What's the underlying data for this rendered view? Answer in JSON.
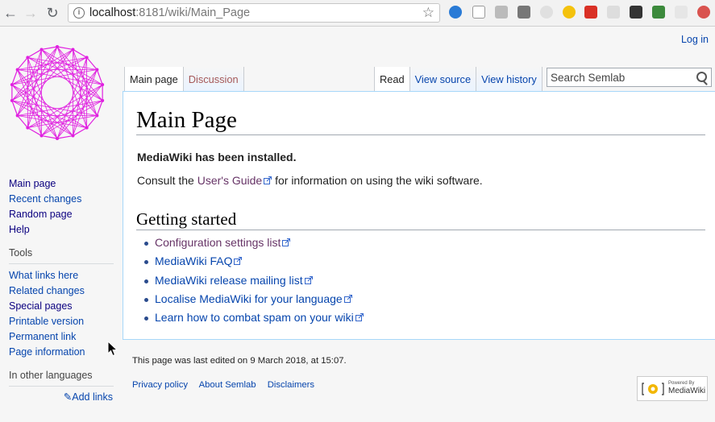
{
  "browser": {
    "url_host": "localhost",
    "url_rest": ":8181/wiki/Main_Page",
    "back_icon": "arrow-left-icon",
    "forward_icon": "arrow-right-icon",
    "reload_icon": "reload-icon",
    "bookmark_icon": "star-icon"
  },
  "personal": {
    "login": "Log in"
  },
  "tabs": {
    "namespaces": [
      {
        "label": "Main page"
      },
      {
        "label": "Discussion"
      }
    ],
    "views": [
      {
        "label": "Read"
      },
      {
        "label": "View source"
      },
      {
        "label": "View history"
      }
    ]
  },
  "search": {
    "placeholder": "Search Semlab"
  },
  "content": {
    "title": "Main Page",
    "installed": "MediaWiki has been installed.",
    "consult_prefix": "Consult the ",
    "consult_link": "User's Guide",
    "consult_suffix": " for information on using the wiki software.",
    "getting_started": "Getting started",
    "links": [
      "Configuration settings list",
      "MediaWiki FAQ",
      "MediaWiki release mailing list",
      "Localise MediaWiki for your language",
      "Learn how to combat spam on your wiki"
    ]
  },
  "sidebar": {
    "navigation": [
      {
        "label": "Main page"
      },
      {
        "label": "Recent changes"
      },
      {
        "label": "Random page"
      },
      {
        "label": "Help"
      }
    ],
    "tools_heading": "Tools",
    "tools": [
      {
        "label": "What links here"
      },
      {
        "label": "Related changes"
      },
      {
        "label": "Special pages"
      },
      {
        "label": "Printable version"
      },
      {
        "label": "Permanent link"
      },
      {
        "label": "Page information"
      }
    ],
    "languages_heading": "In other languages",
    "add_links": "Add links"
  },
  "footer": {
    "last_edited": "This page was last edited on 9 March 2018, at 15:07.",
    "places": [
      "Privacy policy",
      "About Semlab",
      "Disclaimers"
    ],
    "powered_small": "Powered By",
    "powered_big": "MediaWiki"
  },
  "colors": {
    "link": "#0645ad",
    "visited": "#663366",
    "new": "#a55858",
    "logo": "#e020e0"
  }
}
